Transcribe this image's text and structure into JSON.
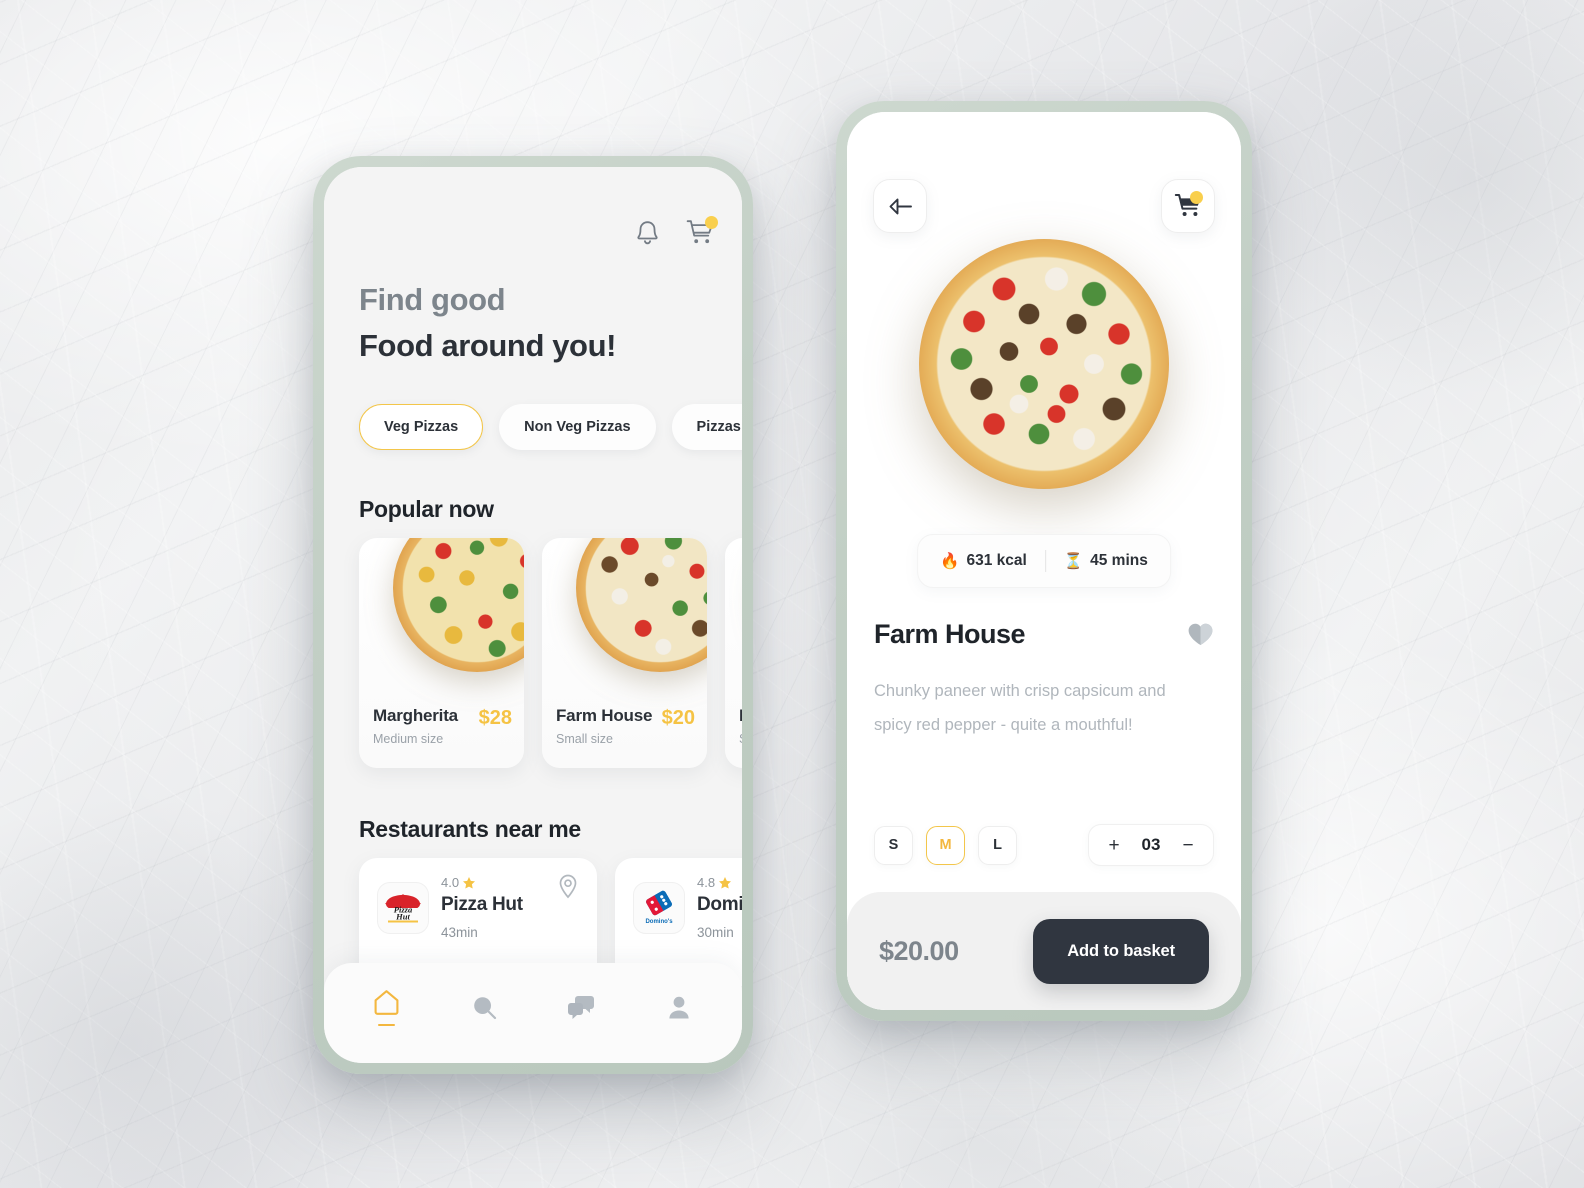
{
  "theme": {
    "accent_yellow": "#f3c64a",
    "price_yellow": "#f5c344",
    "dark": "#2c3138",
    "muted": "#9aa1a8",
    "phone_frame": "#c2cfc5",
    "screen_bg": "#f4f4f4",
    "basket_dark": "#303640"
  },
  "home": {
    "top_icons": {
      "notification": "bell-icon",
      "cart": "shopping-cart-icon",
      "cart_badge": true
    },
    "headline_line1": "Find good",
    "headline_line2": "Food around you!",
    "chips": [
      {
        "label": "Veg Pizzas",
        "active": true
      },
      {
        "label": "Non Veg Pizzas",
        "active": false
      },
      {
        "label": "Pizzas Ma",
        "active": false
      }
    ],
    "popular": {
      "title": "Popular now",
      "cards": [
        {
          "name": "Margherita",
          "size": "Medium size",
          "price": "$28",
          "pizza": "paneer"
        },
        {
          "name": "Farm House",
          "size": "Small size",
          "price": "$20",
          "pizza": "farmhouse"
        },
        {
          "name": "Fo",
          "size": "Sm",
          "price": "",
          "pizza": "paneer"
        }
      ]
    },
    "restaurants": {
      "title": "Restaurants near me",
      "cards": [
        {
          "name": "Pizza Hut",
          "rating": "4.0",
          "time": "43min",
          "logo": "pizza-hut-logo",
          "pin": true
        },
        {
          "name": "Domino",
          "rating": "4.8",
          "time": "30min",
          "logo": "dominos-logo",
          "pin": false
        }
      ]
    },
    "nav": [
      {
        "icon": "home-icon",
        "active": true
      },
      {
        "icon": "search-icon",
        "active": false
      },
      {
        "icon": "chat-icon",
        "active": false
      },
      {
        "icon": "profile-icon",
        "active": false
      }
    ]
  },
  "detail": {
    "back_icon": "back-arrow-icon",
    "cart_icon": "shopping-cart-icon",
    "cart_badge": true,
    "hero_pizza": "farmhouse",
    "info": {
      "calories_emoji": "🔥",
      "calories": "631 kcal",
      "time_emoji": "⏳",
      "time": "45 mins"
    },
    "title": "Farm House",
    "favorite_icon": "heart-icon",
    "description": "Chunky paneer with crisp capsicum and spicy red pepper - quite a mouthful!",
    "sizes": [
      {
        "label": "S",
        "active": false
      },
      {
        "label": "M",
        "active": true
      },
      {
        "label": "L",
        "active": false
      }
    ],
    "quantity": {
      "increase": "+",
      "value": "03",
      "decrease": "−"
    },
    "footer": {
      "price": "$20.00",
      "button": "Add to basket"
    }
  }
}
